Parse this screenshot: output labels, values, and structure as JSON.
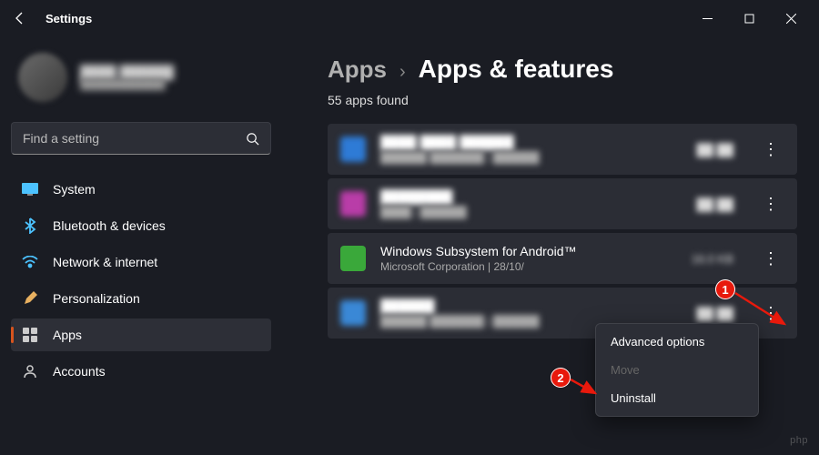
{
  "window": {
    "title": "Settings"
  },
  "search": {
    "placeholder": "Find a setting"
  },
  "nav": {
    "items": [
      {
        "label": "System",
        "icon": "system"
      },
      {
        "label": "Bluetooth & devices",
        "icon": "bluetooth"
      },
      {
        "label": "Network & internet",
        "icon": "network"
      },
      {
        "label": "Personalization",
        "icon": "personalization"
      },
      {
        "label": "Apps",
        "icon": "apps"
      },
      {
        "label": "Accounts",
        "icon": "accounts"
      }
    ],
    "active": 4
  },
  "breadcrumb": {
    "parent": "Apps",
    "current": "Apps & features"
  },
  "apps": {
    "count_text": "55 apps found",
    "list": [
      {
        "name": "████ ████ ██████",
        "meta": "██████ ███████ | ██████",
        "size": "██ ██",
        "icon_color": "#2e7bd6",
        "blurred": true
      },
      {
        "name": "████████",
        "meta": "████ | ██████",
        "size": "██ ██",
        "icon_color": "#b93da8",
        "blurred": true
      },
      {
        "name": "Windows Subsystem for Android™",
        "meta": "Microsoft Corporation  |  28/10/",
        "size": "16.0 KB",
        "icon_color": "#3aa83a",
        "blurred": false
      },
      {
        "name": "██████",
        "meta": "██████ ███████ | ██████",
        "size": "██ ██",
        "icon_color": "#3a88d6",
        "blurred": true
      }
    ]
  },
  "context_menu": {
    "items": [
      {
        "label": "Advanced options",
        "enabled": true
      },
      {
        "label": "Move",
        "enabled": false
      },
      {
        "label": "Uninstall",
        "enabled": true
      }
    ]
  },
  "annotations": {
    "badge1": "1",
    "badge2": "2"
  },
  "watermark": "php"
}
